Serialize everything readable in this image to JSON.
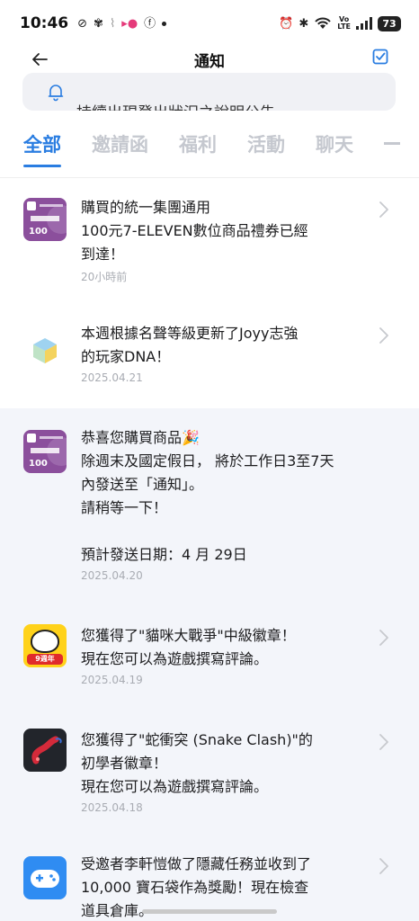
{
  "status": {
    "time": "10:46",
    "battery": "73",
    "volte_top": "Vo",
    "volte_bottom": "LTE"
  },
  "header": {
    "title": "通知"
  },
  "announcement": {
    "text": "持續出現登出狀況之說明公告"
  },
  "tabs": [
    {
      "label": "全部",
      "active": true
    },
    {
      "label": "邀請函",
      "active": false
    },
    {
      "label": "福利",
      "active": false
    },
    {
      "label": "活動",
      "active": false
    },
    {
      "label": "聊天",
      "active": false
    }
  ],
  "notifications": [
    {
      "text": "購買的統一集團通用\n100元7-ELEVEN數位商品禮券已經\n到達！",
      "time": "20小時前",
      "icon": "voucher-icon",
      "amount": "100"
    },
    {
      "text": "本週根據名聲等級更新了Joyy志強\n的玩家DNA！",
      "time": "2025.04.21",
      "icon": "dna-cube-icon"
    },
    {
      "text": "恭喜您購買商品🎉\n除週末及國定假日， 將於工作日3至7天\n內發送至「通知」。\n請稍等一下！\n\n預計發送日期：4 月 29日",
      "time": "2025.04.20",
      "icon": "voucher-icon",
      "amount": "100"
    },
    {
      "text": "您獲得了\"貓咪大戰爭\"中級徽章！\n現在您可以為遊戲撰寫評論。",
      "time": "2025.04.19",
      "icon": "cat-game-icon",
      "badge": "9週年"
    },
    {
      "text": "您獲得了\"蛇衝突 (Snake Clash)\"的\n初學者徽章！\n現在您可以為遊戲撰寫評論。",
      "time": "2025.04.18",
      "icon": "snake-game-icon"
    },
    {
      "text": "受邀者李軒愷做了隱藏任務並收到了\n10,000 寶石袋作為獎勵！現在檢查\n道具倉庫。",
      "time": "",
      "icon": "gamepad-icon"
    }
  ],
  "colors": {
    "accent": "#2a7de1",
    "unread_bg": "#f3f5fa",
    "voucher": "#8b4f9c"
  }
}
